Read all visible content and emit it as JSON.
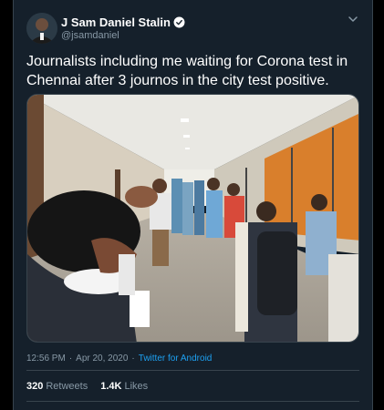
{
  "tweet": {
    "display_name": "J Sam Daniel Stalin",
    "handle": "@jsamdaniel",
    "text": "Journalists including me waiting for Corona test in Chennai after 3 journos in the city test positive.",
    "time": "12:56 PM",
    "date": "Apr 20, 2020",
    "separator": "·",
    "source": "Twitter for Android",
    "retweets_count": "320",
    "retweets_label": "Retweets",
    "likes_count": "1.4K",
    "likes_label": "Likes"
  },
  "icons": {
    "verified": "verified-badge-icon",
    "menu": "chevron-down-icon"
  },
  "colors": {
    "background": "#15202b",
    "page": "#000000",
    "text": "#ffffff",
    "secondary": "#8899a6",
    "accent": "#1da1f2",
    "border": "#38444d"
  }
}
